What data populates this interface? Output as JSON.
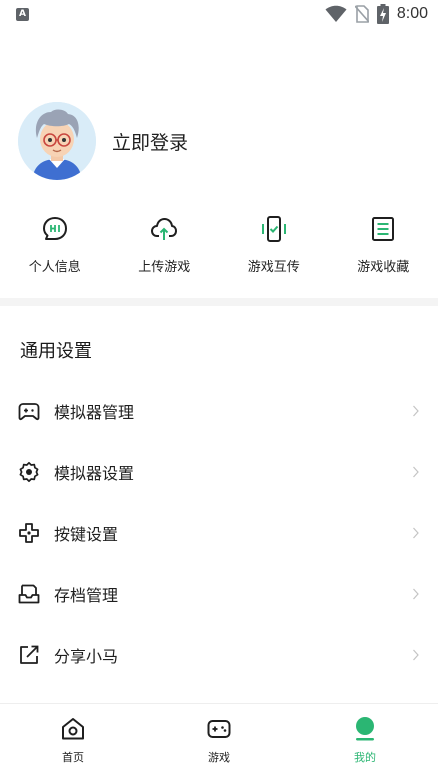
{
  "status_bar": {
    "notification_glyph": "A",
    "time": "8:00",
    "icons": [
      "wifi-icon",
      "no-sim-icon",
      "battery-charging-icon"
    ]
  },
  "profile": {
    "login_label": "立即登录",
    "avatar_icon": "user-avatar"
  },
  "quick_actions": [
    {
      "label": "个人信息",
      "icon": "chat-hi-icon"
    },
    {
      "label": "上传游戏",
      "icon": "cloud-upload-icon"
    },
    {
      "label": "游戏互传",
      "icon": "phone-transfer-icon"
    },
    {
      "label": "游戏收藏",
      "icon": "list-document-icon"
    }
  ],
  "settings": {
    "title": "通用设置",
    "items": [
      {
        "label": "模拟器管理",
        "icon": "gamepad-icon"
      },
      {
        "label": "模拟器设置",
        "icon": "gear-icon"
      },
      {
        "label": "按键设置",
        "icon": "dpad-icon"
      },
      {
        "label": "存档管理",
        "icon": "inbox-icon"
      },
      {
        "label": "分享小马",
        "icon": "share-icon"
      }
    ]
  },
  "bottom_nav": {
    "items": [
      {
        "label": "首页",
        "icon": "home-icon",
        "active": false
      },
      {
        "label": "游戏",
        "icon": "controller-icon",
        "active": false
      },
      {
        "label": "我的",
        "icon": "profile-icon",
        "active": true
      }
    ]
  },
  "colors": {
    "accent": "#2bb673",
    "text": "#1f1f1f",
    "chevron": "#c4c4c4",
    "divider": "#f4f4f4"
  }
}
